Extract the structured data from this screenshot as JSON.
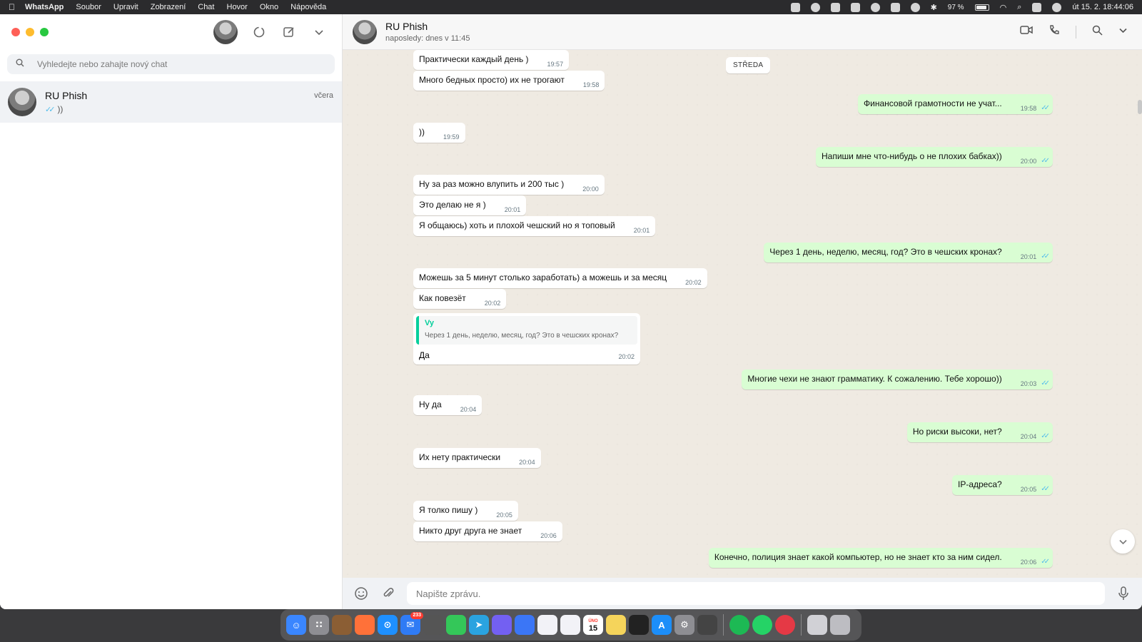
{
  "menubar": {
    "app": "WhatsApp",
    "items": [
      "Soubor",
      "Upravit",
      "Zobrazení",
      "Chat",
      "Hovor",
      "Okno",
      "Nápověda"
    ],
    "battery": "97 %",
    "datetime": "út 15. 2.  18:44:06"
  },
  "sidebar": {
    "search_placeholder": "Vyhledejte nebo zahajte nový chat",
    "chats": [
      {
        "name": "RU Phish",
        "time": "včera",
        "preview": "))"
      }
    ]
  },
  "chat": {
    "name": "RU Phish",
    "status": "naposledy: dnes v 11:45",
    "day_label": "STŘEDA",
    "composer_placeholder": "Napište zprávu.",
    "messages": [
      {
        "dir": "in",
        "text": "Практически каждый день )",
        "time": "19:57"
      },
      {
        "dir": "in",
        "text": "Много бедных просто) их не трогают",
        "time": "19:58"
      },
      {
        "dir": "out",
        "text": "Финансовой грамотности не учат...",
        "time": "19:58"
      },
      {
        "dir": "in",
        "text": "))",
        "time": "19:59"
      },
      {
        "dir": "out",
        "text": "Напиши мне что-нибудь о не плохих бабках))",
        "time": "20:00"
      },
      {
        "dir": "in",
        "text": "Ну за раз можно влупить и 200 тыс )",
        "time": "20:00"
      },
      {
        "dir": "in",
        "text": "Это делаю не я )",
        "time": "20:01"
      },
      {
        "dir": "in",
        "text": "Я общаюсь) хоть и плохой чешский но я топовый",
        "time": "20:01"
      },
      {
        "dir": "out",
        "text": "Через 1 день, неделю, месяц, год? Это в чешских кронах?",
        "time": "20:01"
      },
      {
        "dir": "in",
        "text": "Можешь за 5 минут столько заработать) а можешь и за месяц",
        "time": "20:02"
      },
      {
        "dir": "in",
        "text": "Как повезёт",
        "time": "20:02"
      },
      {
        "dir": "out",
        "text": "Многие чехи не знают грамматику. К сожалению. Тебе хорошо))",
        "time": "20:03"
      },
      {
        "dir": "in",
        "text": "Ну да",
        "time": "20:04"
      },
      {
        "dir": "out",
        "text": "Но риски высоки, нет?",
        "time": "20:04"
      },
      {
        "dir": "in",
        "text": "Их нету практически",
        "time": "20:04"
      },
      {
        "dir": "out",
        "text": "IP-адреса?",
        "time": "20:05"
      },
      {
        "dir": "in",
        "text": "Я толко пишу )",
        "time": "20:05"
      },
      {
        "dir": "in",
        "text": "Никто друг друга не знает",
        "time": "20:06"
      },
      {
        "dir": "out",
        "text": "Конечно, полиция знает какой компьютер, но не знает кто за ним сидел.",
        "time": "20:06"
      }
    ],
    "reply": {
      "quote_author": "Vy",
      "quote_text": "Через 1 день, неделю, месяц, год? Это в чешских кронах?",
      "text": "Да",
      "time": "20:02"
    }
  },
  "dock": {
    "calendar_day": "15",
    "calendar_month": "ÚNO",
    "mail_badge": "233"
  },
  "colors": {
    "incoming_bubble": "#ffffff",
    "outgoing_bubble": "#d9fdd3",
    "read_ticks": "#53bdeb",
    "quote_accent": "#06cf9c"
  }
}
